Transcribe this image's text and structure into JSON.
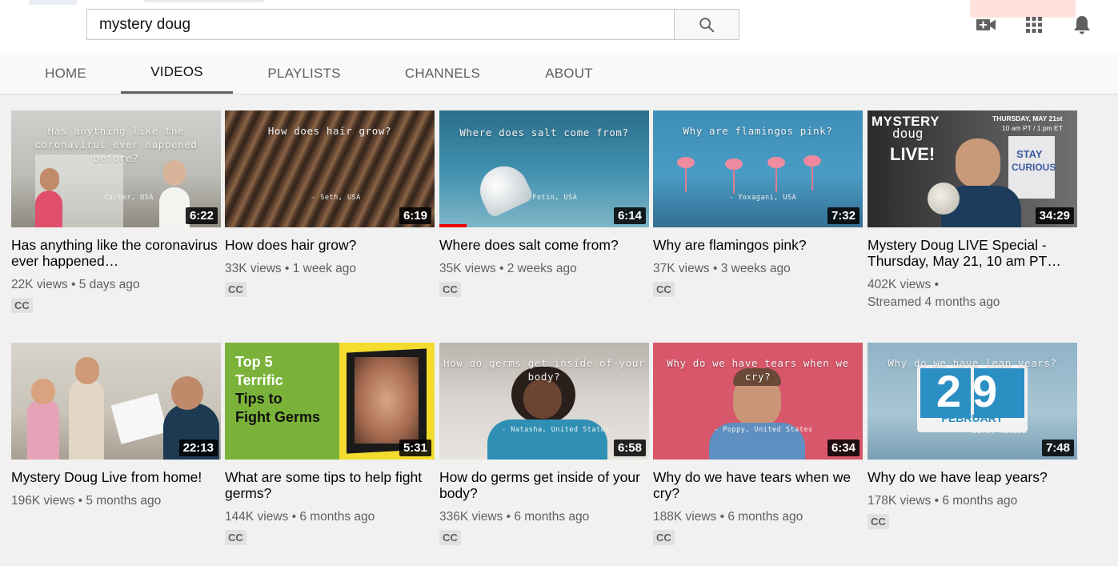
{
  "search": {
    "value": "mystery doug"
  },
  "tabs": [
    {
      "label": "HOME"
    },
    {
      "label": "VIDEOS"
    },
    {
      "label": "PLAYLISTS"
    },
    {
      "label": "CHANNELS"
    },
    {
      "label": "ABOUT"
    }
  ],
  "icons": {
    "search": "search-icon",
    "create": "video-camera-plus-icon",
    "apps": "apps-grid-icon",
    "notifications": "bell-icon"
  },
  "videos": [
    {
      "thumb_text": "Has anything like the coronavirus ever happened before?",
      "credit": "- Carter, USA",
      "duration": "6:22",
      "title": "Has anything like the coronavirus ever happened…",
      "views": "22K views",
      "age": "5 days ago",
      "cc": "CC"
    },
    {
      "thumb_text": "How does hair grow?",
      "credit": "- Seth, USA",
      "duration": "6:19",
      "title": "How does hair grow?",
      "views": "33K views",
      "age": "1 week ago",
      "cc": "CC"
    },
    {
      "thumb_text": "Where does salt come from?",
      "credit": "- Fotin, USA",
      "duration": "6:14",
      "title": "Where does salt come from?",
      "views": "35K views",
      "age": "2 weeks ago",
      "cc": "CC",
      "watched": 0.13
    },
    {
      "thumb_text": "Why are flamingos pink?",
      "credit": "- Yoxagani, USA",
      "duration": "7:32",
      "title": "Why are flamingos pink?",
      "views": "37K views",
      "age": "3 weeks ago",
      "cc": "CC"
    },
    {
      "thumb_brand": "MYSTERY",
      "thumb_brand2": "doug",
      "thumb_live": "LIVE!",
      "thumb_date": "THURSDAY, MAY 21st",
      "thumb_time": "10 am PT / 1 pm ET",
      "thumb_sign1": "STAY",
      "thumb_sign2": "CURIOUS",
      "duration": "34:29",
      "title": "Mystery Doug LIVE Special - Thursday, May 21, 10 am PT…",
      "views": "402K views",
      "age": "Streamed 4 months ago"
    },
    {
      "duration": "22:13",
      "title": "Mystery Doug Live from home!",
      "views": "196K views",
      "age": "5 months ago"
    },
    {
      "thumb_lines": [
        "Top 5",
        "Terrific",
        "Tips to",
        "Fight Germs"
      ],
      "duration": "5:31",
      "title": "What are some tips to help fight germs?",
      "views": "144K views",
      "age": "6 months ago",
      "cc": "CC"
    },
    {
      "thumb_text": "How do germs get inside of your body?",
      "credit": "- Natasha, United States",
      "duration": "6:58",
      "title": "How do germs get inside of your body?",
      "views": "336K views",
      "age": "6 months ago",
      "cc": "CC"
    },
    {
      "thumb_text": "Why do we have tears when we cry?",
      "credit": "- Poppy, United States",
      "duration": "6:34",
      "title": "Why do we have tears when we cry?",
      "views": "188K views",
      "age": "6 months ago",
      "cc": "CC"
    },
    {
      "thumb_text": "Why do we have leap years?",
      "credit": "- Sire, Hawaii",
      "thumb_day": "29",
      "thumb_month": "FEBRUARY",
      "duration": "7:48",
      "title": "Why do we have leap years?",
      "views": "178K views",
      "age": "6 months ago",
      "cc": "CC"
    }
  ]
}
